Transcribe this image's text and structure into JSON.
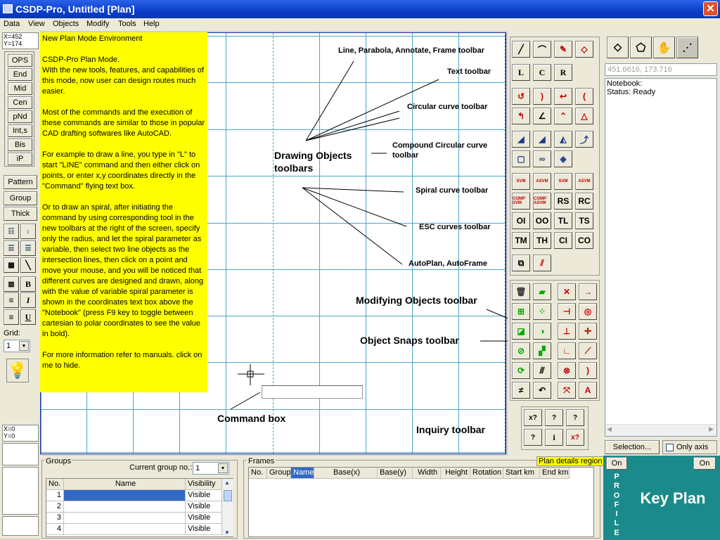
{
  "window": {
    "title": "CSDP-Pro, Untitled [Plan]"
  },
  "menu": [
    "Data",
    "View",
    "Objects",
    "Modify",
    "Tools",
    "Help"
  ],
  "cursor_readout": {
    "x": "X=452",
    "y": "Y=174"
  },
  "cursor_readout2": {
    "x": "X=0",
    "y": "Y=0"
  },
  "snap_buttons": [
    "OPS",
    "End",
    "Mid",
    "Cen",
    "pNd",
    "Int,s",
    "Bis",
    "iP"
  ],
  "left_buttons": [
    "Pattern",
    "Group",
    "Thick"
  ],
  "grid": {
    "label": "Grid:",
    "value": "1"
  },
  "info_text": "New Plan Mode Environment\n\nCSDP-Pro Plan Mode.\nWith the new tools, features, and capabilities of this mode, now user can design routes much easier.\n\nMost of the commands and the execution of these commands are similar to those in popular CAD drafting softwares like AutoCAD.\n\nFor example to draw a line, you type in \"L\" to start \"LINE\" command and then either click on points, or enter x,y coordinates directly in the \"Command\" flying text box.\n\nOr to draw an spiral, after initiating the command by using corresponding tool in the new toolbars at the right of the screen, specify only the radius, and let the spiral parameter as variable, then select two line objects as the intersection lines, then click on a point and move your mouse, and you will be noticed that different curves are designed and drawn, along with the value of variable spiral parameter is shown in the coordinates text box above the \"Notebook\" (press F9 key to toggle between cartesian to polar coordinates to see the value in bold).\n\nFor more information refer to manuals. click on me to hide.",
  "annotations": {
    "line_toolbar": "Line, Parabola, Annotate, Frame toolbar",
    "text_toolbar": "Text toolbar",
    "circular_toolbar": "Circular curve toolbar",
    "compound_toolbar": "Compound Circular curve toolbar",
    "drawing_objects": "Drawing Objects toolbars",
    "spiral_toolbar": "Spiral curve toolbar",
    "esc_toolbar": "ESC curves toolbar",
    "autoplan": "AutoPlan, AutoFrame",
    "modifying": "Modifying Objects toolbar",
    "snaps": "Object Snaps toolbar",
    "command_box": "Command box",
    "inquiry": "Inquiry toolbar"
  },
  "toolbar_text": {
    "text_tools": [
      "L",
      "C",
      "R"
    ],
    "spiral_labels": [
      "SVM",
      "ASVM",
      "SVM",
      "ASVM"
    ],
    "esc_row1": [
      "COMP SVM",
      "COMP ASVM",
      "RS",
      "RC"
    ],
    "esc_row2": [
      "OI",
      "OO",
      "TL",
      "TS"
    ],
    "esc_row3": [
      "TM",
      "TH",
      "CI",
      "CO"
    ]
  },
  "inquiry_text": [
    "x?",
    "?",
    "?",
    "?",
    "i",
    "x?"
  ],
  "coord_box": "451.6616, 173.716",
  "notebook": {
    "line1": "Notebook:",
    "line2": "Status: Ready"
  },
  "selection_button": "Selection...",
  "only_axis": "Only axis",
  "groups": {
    "title": "Groups",
    "current_label": "Current group no.:",
    "current_value": "1",
    "columns": [
      "No.",
      "Name",
      "Visibility"
    ],
    "rows": [
      {
        "no": "1",
        "name": "",
        "vis": "Visible"
      },
      {
        "no": "2",
        "name": "",
        "vis": "Visible"
      },
      {
        "no": "3",
        "name": "",
        "vis": "Visible"
      },
      {
        "no": "4",
        "name": "",
        "vis": "Visible"
      }
    ]
  },
  "frames": {
    "title": "Frames",
    "badge": "Plan details region",
    "columns": [
      "No.",
      "Group",
      "Name",
      "Base(x)",
      "Base(y)",
      "Width",
      "Height",
      "Rotation",
      "Start km",
      "End km"
    ]
  },
  "profile": {
    "on": "On",
    "letters": [
      "P",
      "R",
      "O",
      "F",
      "I",
      "L",
      "E"
    ]
  },
  "keyplan": {
    "on": "On",
    "label": "Key Plan"
  },
  "colors": {
    "accent": "#0a3fc8",
    "canvas_grid": "#4aa8c8",
    "info_bg": "#ffff00",
    "teal": "#1b8a8a"
  }
}
